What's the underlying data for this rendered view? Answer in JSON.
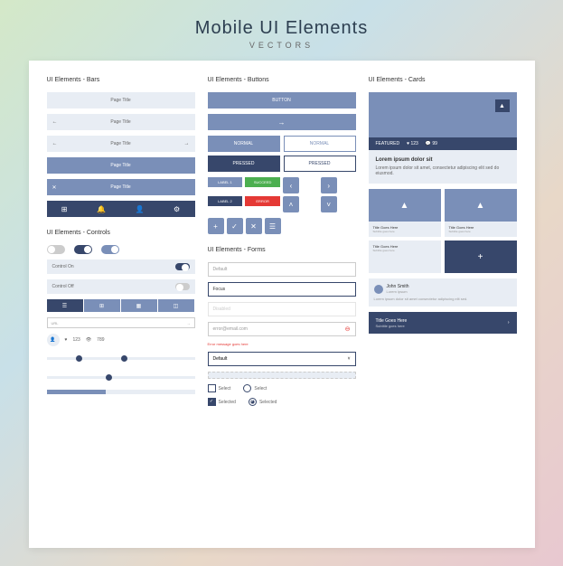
{
  "header": {
    "title": "Mobile UI Elements",
    "subtitle": "VECTORS"
  },
  "sections": {
    "bars": "UI Elements - Bars",
    "buttons": "UI Elements - Buttons",
    "cards": "UI Elements - Cards",
    "controls": "UI Elements - Controls",
    "forms": "UI Elements - Forms"
  },
  "bars": {
    "pageTitle": "Page Title"
  },
  "buttons": {
    "main": "BUTTON",
    "arrow": "→",
    "normal": "NORMAL",
    "pressed": "PRESSED",
    "label1": "LABEL 1",
    "succeed": "SUCCEED",
    "label2": "LABEL 2",
    "error": "ERROR"
  },
  "cards": {
    "featured": "FEATURED",
    "likes": "123",
    "comments": "99",
    "title": "Lorem ipsum dolor sit",
    "body": "Lorem ipsum dolor sit amet, consectetur adipiscing elit sed do eiusmod.",
    "small": {
      "title": "Title Goes Here",
      "sub": "Subtitle goes here"
    },
    "review": {
      "name": "John Smith",
      "sub": "Lorem ipsum",
      "text": "Lorem ipsum dolor sit amet consectetur adipiscing elit sed."
    },
    "footer": {
      "title": "Title Goes Here",
      "sub": "Subtitle goes here"
    }
  },
  "controls": {
    "on": "Control On",
    "off": "Control Off",
    "url": "URL",
    "go": "→",
    "likes": "123",
    "views": "789"
  },
  "forms": {
    "default": "Default",
    "focus": "Focus",
    "disabled": "Disabled",
    "email": "error@email.com",
    "errmsg": "Error message goes here",
    "select": "Select",
    "selected": "Selected"
  }
}
